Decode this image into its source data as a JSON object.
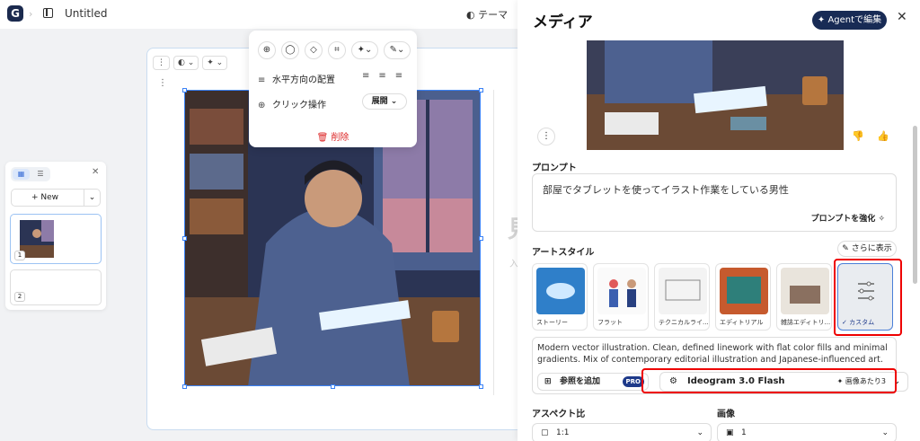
{
  "topbar": {
    "doc_title": "Untitled",
    "theme_label": "テーマ"
  },
  "canvas": {
    "ghost_char": "見",
    "ghost_sub": "入"
  },
  "popup": {
    "align_label": "水平方向の配置",
    "click_label": "クリック操作",
    "click_value": "展開",
    "delete_label": "削除"
  },
  "pages": {
    "new_label": "New",
    "pages": [
      {
        "num": "1"
      },
      {
        "num": "2"
      }
    ]
  },
  "panel": {
    "title": "メディア",
    "agent_label": "Agentで編集",
    "prompt_label": "プロンプト",
    "prompt_text": "部屋でタブレットを使ってイラスト作業をしている男性",
    "enhance_label": "プロンプトを強化",
    "art_style_label": "アートスタイル",
    "more_label": "さらに表示",
    "styles": [
      {
        "label": "ストーリー"
      },
      {
        "label": "フラット"
      },
      {
        "label": "テクニカルライ..."
      },
      {
        "label": "エディトリアル"
      },
      {
        "label": "雑誌エディトリ..."
      },
      {
        "label": "カスタム"
      }
    ],
    "style_desc": "Modern vector illustration. Clean, defined linework with flat color fills and minimal gradients. Mix of contemporary editorial illustration and Japanese-influenced art.",
    "ref_label": "参照を追加",
    "pro_label": "PRO",
    "model_name": "Ideogram 3.0 Flash",
    "model_per": "画像あたり3",
    "aspect_label": "アスペクト比",
    "aspect_value": "1:1",
    "images_label": "画像",
    "images_value": "1"
  }
}
